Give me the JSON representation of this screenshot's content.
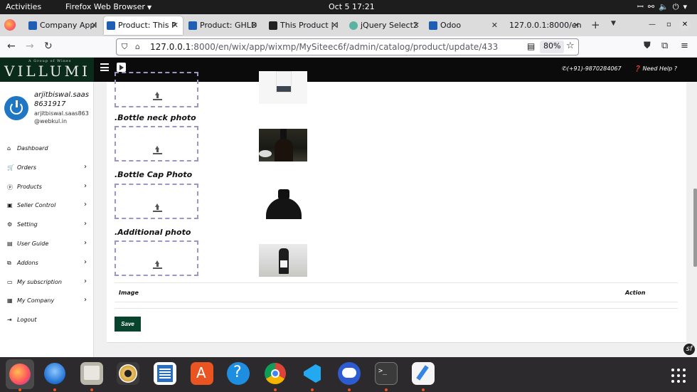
{
  "topbar": {
    "activities": "Activities",
    "app_name": "Firefox Web Browser",
    "clock": "Oct 5  17:21"
  },
  "tabs": [
    {
      "title": "Company Appl",
      "icon": "company-favicon",
      "color": "#1e5fb4",
      "active": false
    },
    {
      "title": "Product: This P",
      "icon": "company-favicon",
      "color": "#1e5fb4",
      "active": true
    },
    {
      "title": "Product: GHLD",
      "icon": "company-favicon",
      "color": "#1e5fb4",
      "active": false
    },
    {
      "title": "This Product | I",
      "icon": "wix-favicon",
      "color": "#222222",
      "active": false
    },
    {
      "title": "jQuery Select2",
      "icon": "select2-favicon",
      "color": "#5ab3a0",
      "active": false
    },
    {
      "title": "Odoo",
      "icon": "company-favicon",
      "color": "#1e5fb4",
      "active": false
    },
    {
      "title": "127.0.0.1:8000/en",
      "icon": "none",
      "color": "",
      "active": false
    }
  ],
  "navbar": {
    "url_host": "127.0.0.1",
    "url_rest": ":8000/en/wix/app/wixmp/MySiteec6f/admin/catalog/product/update/433",
    "zoom": "80%"
  },
  "site": {
    "logo_small": "A Group of Wines",
    "logo_big": "VILLUMI",
    "contact": "(+91)-9870284067",
    "help": "Need Help ?"
  },
  "user": {
    "name": "arjitbiswal.saas8631917",
    "email": "arjitbiswal.saas863@webkul.in"
  },
  "menu": [
    {
      "label": "Dashboard",
      "icon": "home-icon",
      "has_arrow": false
    },
    {
      "label": "Orders",
      "icon": "cart-icon",
      "has_arrow": true
    },
    {
      "label": "Products",
      "icon": "product-icon",
      "has_arrow": true
    },
    {
      "label": "Seller Control",
      "icon": "seller-icon",
      "has_arrow": true
    },
    {
      "label": "Setting",
      "icon": "settings-icon",
      "has_arrow": true
    },
    {
      "label": "User Guide",
      "icon": "book-icon",
      "has_arrow": true
    },
    {
      "label": "Addons",
      "icon": "addons-icon",
      "has_arrow": true
    },
    {
      "label": "My subscription",
      "icon": "subscription-icon",
      "has_arrow": true
    },
    {
      "label": "My Company",
      "icon": "company-icon",
      "has_arrow": true
    },
    {
      "label": "Logout",
      "icon": "logout-icon",
      "has_arrow": false
    }
  ],
  "photos": [
    {
      "label": ".Bottle neck photo"
    },
    {
      "label": ".Bottle Cap Photo"
    },
    {
      "label": ".Additional photo"
    }
  ],
  "table": {
    "col_image": "Image",
    "col_action": "Action"
  },
  "save_label": "Save"
}
